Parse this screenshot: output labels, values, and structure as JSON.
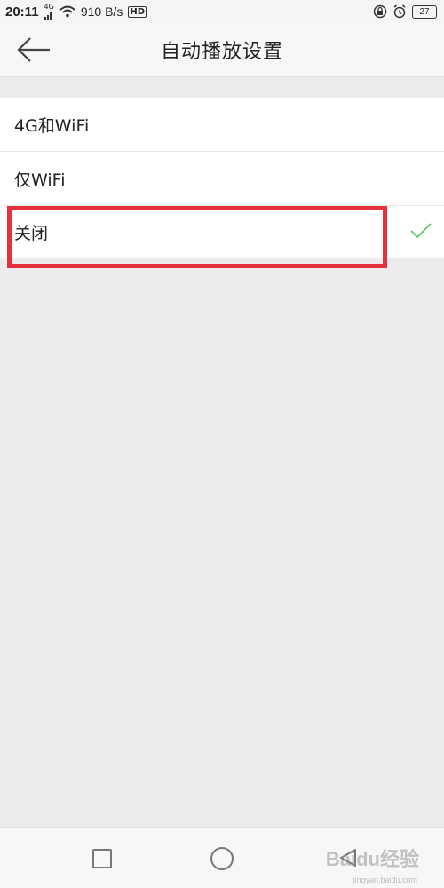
{
  "status_bar": {
    "time": "20:11",
    "network_type": "4G",
    "speed": "910 B/s",
    "hd": "HD",
    "battery": "27"
  },
  "header": {
    "title": "自动播放设置"
  },
  "options": [
    {
      "label": "4G和WiFi",
      "selected": false
    },
    {
      "label": "仅WiFi",
      "selected": false
    },
    {
      "label": "关闭",
      "selected": true
    }
  ],
  "colors": {
    "accent_check": "#5cc96b",
    "highlight_border": "#e5323c"
  },
  "watermark": {
    "brand": "Baidu经验",
    "url": "jingyan.baidu.com"
  }
}
